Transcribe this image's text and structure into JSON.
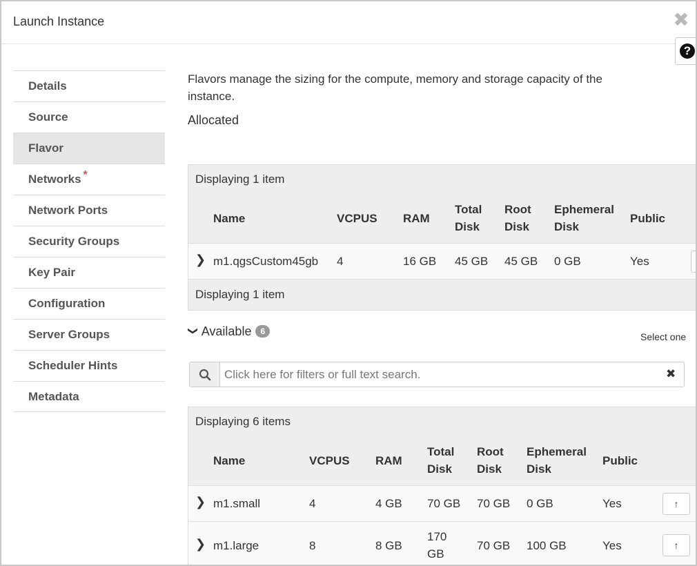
{
  "dialog": {
    "title": "Launch Instance",
    "close_glyph": "✖",
    "help_glyph": "?"
  },
  "nav": {
    "items": [
      {
        "label": "Details"
      },
      {
        "label": "Source"
      },
      {
        "label": "Flavor"
      },
      {
        "label": "Networks",
        "required": "*"
      },
      {
        "label": "Network Ports"
      },
      {
        "label": "Security Groups"
      },
      {
        "label": "Key Pair"
      },
      {
        "label": "Configuration"
      },
      {
        "label": "Server Groups"
      },
      {
        "label": "Scheduler Hints"
      },
      {
        "label": "Metadata"
      }
    ]
  },
  "main": {
    "description": "Flavors manage the sizing for the compute, memory and storage capacity of the instance.",
    "allocated_label": "Allocated",
    "allocated_table": {
      "count_text": "Displaying 1 item",
      "columns": {
        "name": "Name",
        "vcpus": "VCPUS",
        "ram": "RAM",
        "total_disk": [
          "Total",
          "Disk"
        ],
        "root_disk": [
          "Root",
          "Disk"
        ],
        "ephemeral_disk": [
          "Ephemeral",
          "Disk"
        ],
        "public": "Public"
      },
      "rows": [
        {
          "name": "m1.qgsCustom45gb",
          "vcpus": "4",
          "ram": "16 GB",
          "total_disk": "45 GB",
          "root_disk": "45 GB",
          "ephemeral": "0 GB",
          "public": "Yes"
        }
      ],
      "footer_text": "Displaying 1 item"
    },
    "available": {
      "label": "Available",
      "count": "6",
      "hint": "Select one"
    },
    "search": {
      "placeholder": "Click here for filters or full text search.",
      "clear_glyph": "✖"
    },
    "available_table": {
      "count_text": "Displaying 6 items",
      "columns": {
        "name": "Name",
        "vcpus": "VCPUS",
        "ram": "RAM",
        "total_disk": [
          "Total",
          "Disk"
        ],
        "root_disk": [
          "Root",
          "Disk"
        ],
        "ephemeral_disk": [
          "Ephemeral",
          "Disk"
        ],
        "public": "Public"
      },
      "rows": [
        {
          "name": "m1.small",
          "vcpus": "4",
          "ram": "4 GB",
          "total_disk": "70 GB",
          "root_disk": "70 GB",
          "ephemeral": "0 GB",
          "public": "Yes"
        },
        {
          "name": "m1.large",
          "vcpus": "8",
          "ram": "8 GB",
          "total_disk": [
            "170",
            "GB"
          ],
          "root_disk": "70 GB",
          "ephemeral": "100 GB",
          "public": "Yes"
        }
      ]
    }
  }
}
